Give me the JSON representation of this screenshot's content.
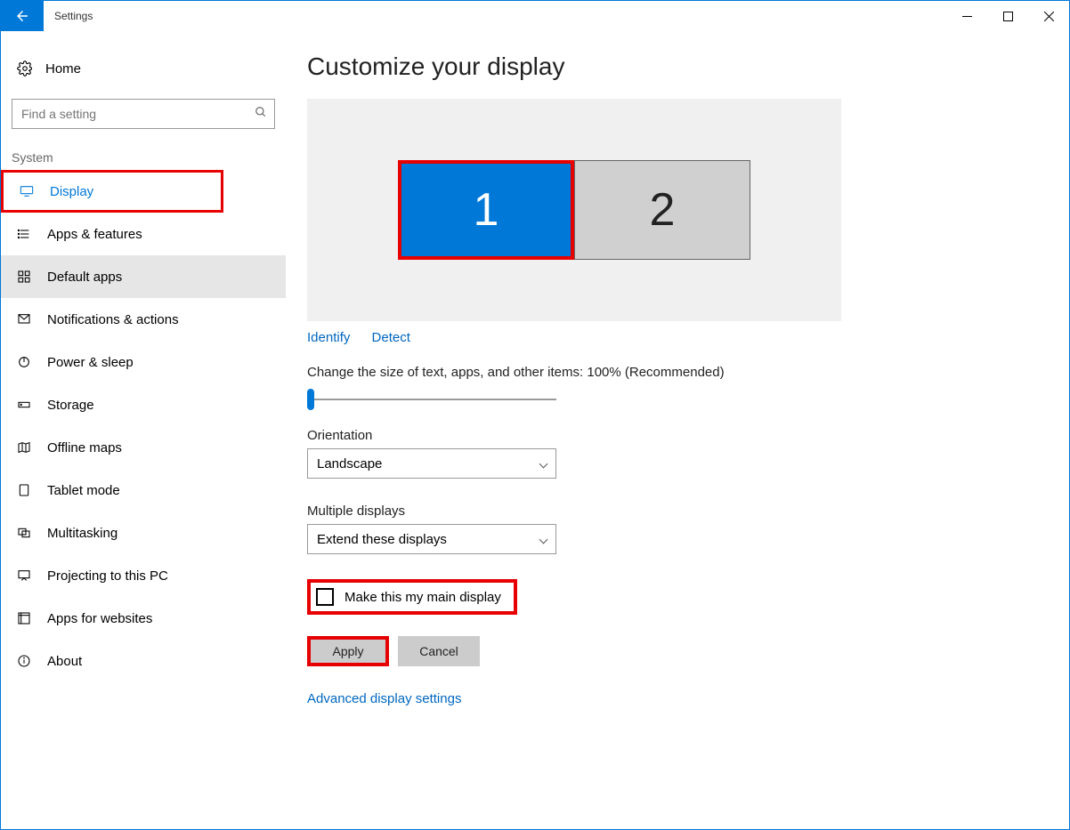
{
  "window_title": "Settings",
  "home_label": "Home",
  "search_placeholder": "Find a setting",
  "section_label": "System",
  "sidebar": [
    {
      "key": "display",
      "label": "Display",
      "active": true,
      "selected": false
    },
    {
      "key": "apps-features",
      "label": "Apps & features"
    },
    {
      "key": "default-apps",
      "label": "Default apps",
      "selected": true
    },
    {
      "key": "notifications",
      "label": "Notifications & actions"
    },
    {
      "key": "power-sleep",
      "label": "Power & sleep"
    },
    {
      "key": "storage",
      "label": "Storage"
    },
    {
      "key": "offline-maps",
      "label": "Offline maps"
    },
    {
      "key": "tablet-mode",
      "label": "Tablet mode"
    },
    {
      "key": "multitasking",
      "label": "Multitasking"
    },
    {
      "key": "projecting",
      "label": "Projecting to this PC"
    },
    {
      "key": "apps-websites",
      "label": "Apps for websites"
    },
    {
      "key": "about",
      "label": "About"
    }
  ],
  "page_title": "Customize your display",
  "monitors": {
    "m1": "1",
    "m2": "2"
  },
  "identify_label": "Identify",
  "detect_label": "Detect",
  "scale_text": "Change the size of text, apps, and other items: 100% (Recommended)",
  "orientation_label": "Orientation",
  "orientation_value": "Landscape",
  "multidisplays_label": "Multiple displays",
  "multidisplays_value": "Extend these displays",
  "maindisplay_label": "Make this my main display",
  "apply_label": "Apply",
  "cancel_label": "Cancel",
  "advanced_label": "Advanced display settings"
}
